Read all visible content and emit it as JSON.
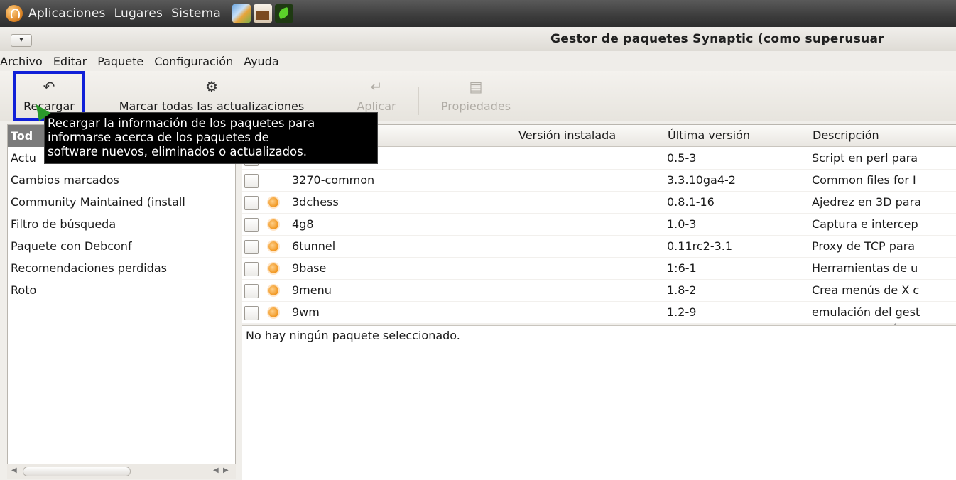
{
  "panel": {
    "menus": [
      "Aplicaciones",
      "Lugares",
      "Sistema"
    ],
    "launchers": [
      "firefox-icon",
      "mail-icon",
      "terminal-icon"
    ]
  },
  "window": {
    "title": "Gestor de paquetes Synaptic (como superusuar",
    "menu_button": "▾"
  },
  "menubar": [
    "Archivo",
    "Editar",
    "Paquete",
    "Configuración",
    "Ayuda"
  ],
  "toolbar": {
    "reload": "Recargar",
    "mark_all": "Marcar todas las actualizaciones",
    "apply": "Aplicar",
    "properties": "Propiedades"
  },
  "tooltip": [
    "Recargar la información de los paquetes para",
    "informarse acerca de los paquetes de",
    "software nuevos, eliminados o actualizados."
  ],
  "filters": {
    "items": [
      "Tod",
      "Actu",
      "Cambios marcados",
      "Community Maintained (install",
      "Filtro de búsqueda",
      "Paquete con Debconf",
      "Recomendaciones perdidas",
      "Roto"
    ],
    "selected_index": 0
  },
  "table": {
    "columns": [
      "",
      "Versión instalada",
      "Última versión",
      "Descripción"
    ],
    "rows": [
      {
        "name": "",
        "installed": "",
        "latest": "0.5-3",
        "desc": "Script en perl para",
        "supported": false
      },
      {
        "name": "3270-common",
        "installed": "",
        "latest": "3.3.10ga4-2",
        "desc": "Common files for I",
        "supported": false
      },
      {
        "name": "3dchess",
        "installed": "",
        "latest": "0.8.1-16",
        "desc": "Ajedrez en 3D para",
        "supported": true
      },
      {
        "name": "4g8",
        "installed": "",
        "latest": "1.0-3",
        "desc": "Captura e intercep",
        "supported": true
      },
      {
        "name": "6tunnel",
        "installed": "",
        "latest": "0.11rc2-3.1",
        "desc": "Proxy de TCP para",
        "supported": true
      },
      {
        "name": "9base",
        "installed": "",
        "latest": "1:6-1",
        "desc": "Herramientas de u",
        "supported": true
      },
      {
        "name": "9menu",
        "installed": "",
        "latest": "1.8-2",
        "desc": "Crea menús de X c",
        "supported": true
      },
      {
        "name": "9wm",
        "installed": "",
        "latest": "1.2-9",
        "desc": "emulación del gest",
        "supported": true
      }
    ]
  },
  "description": "No hay ningún paquete seleccionado.",
  "colors": {
    "focus_box": "#1020d8",
    "selected_filter": "#7b7b7b",
    "tooltip_bg": "#000000",
    "supported_icon": "#f0951e"
  }
}
